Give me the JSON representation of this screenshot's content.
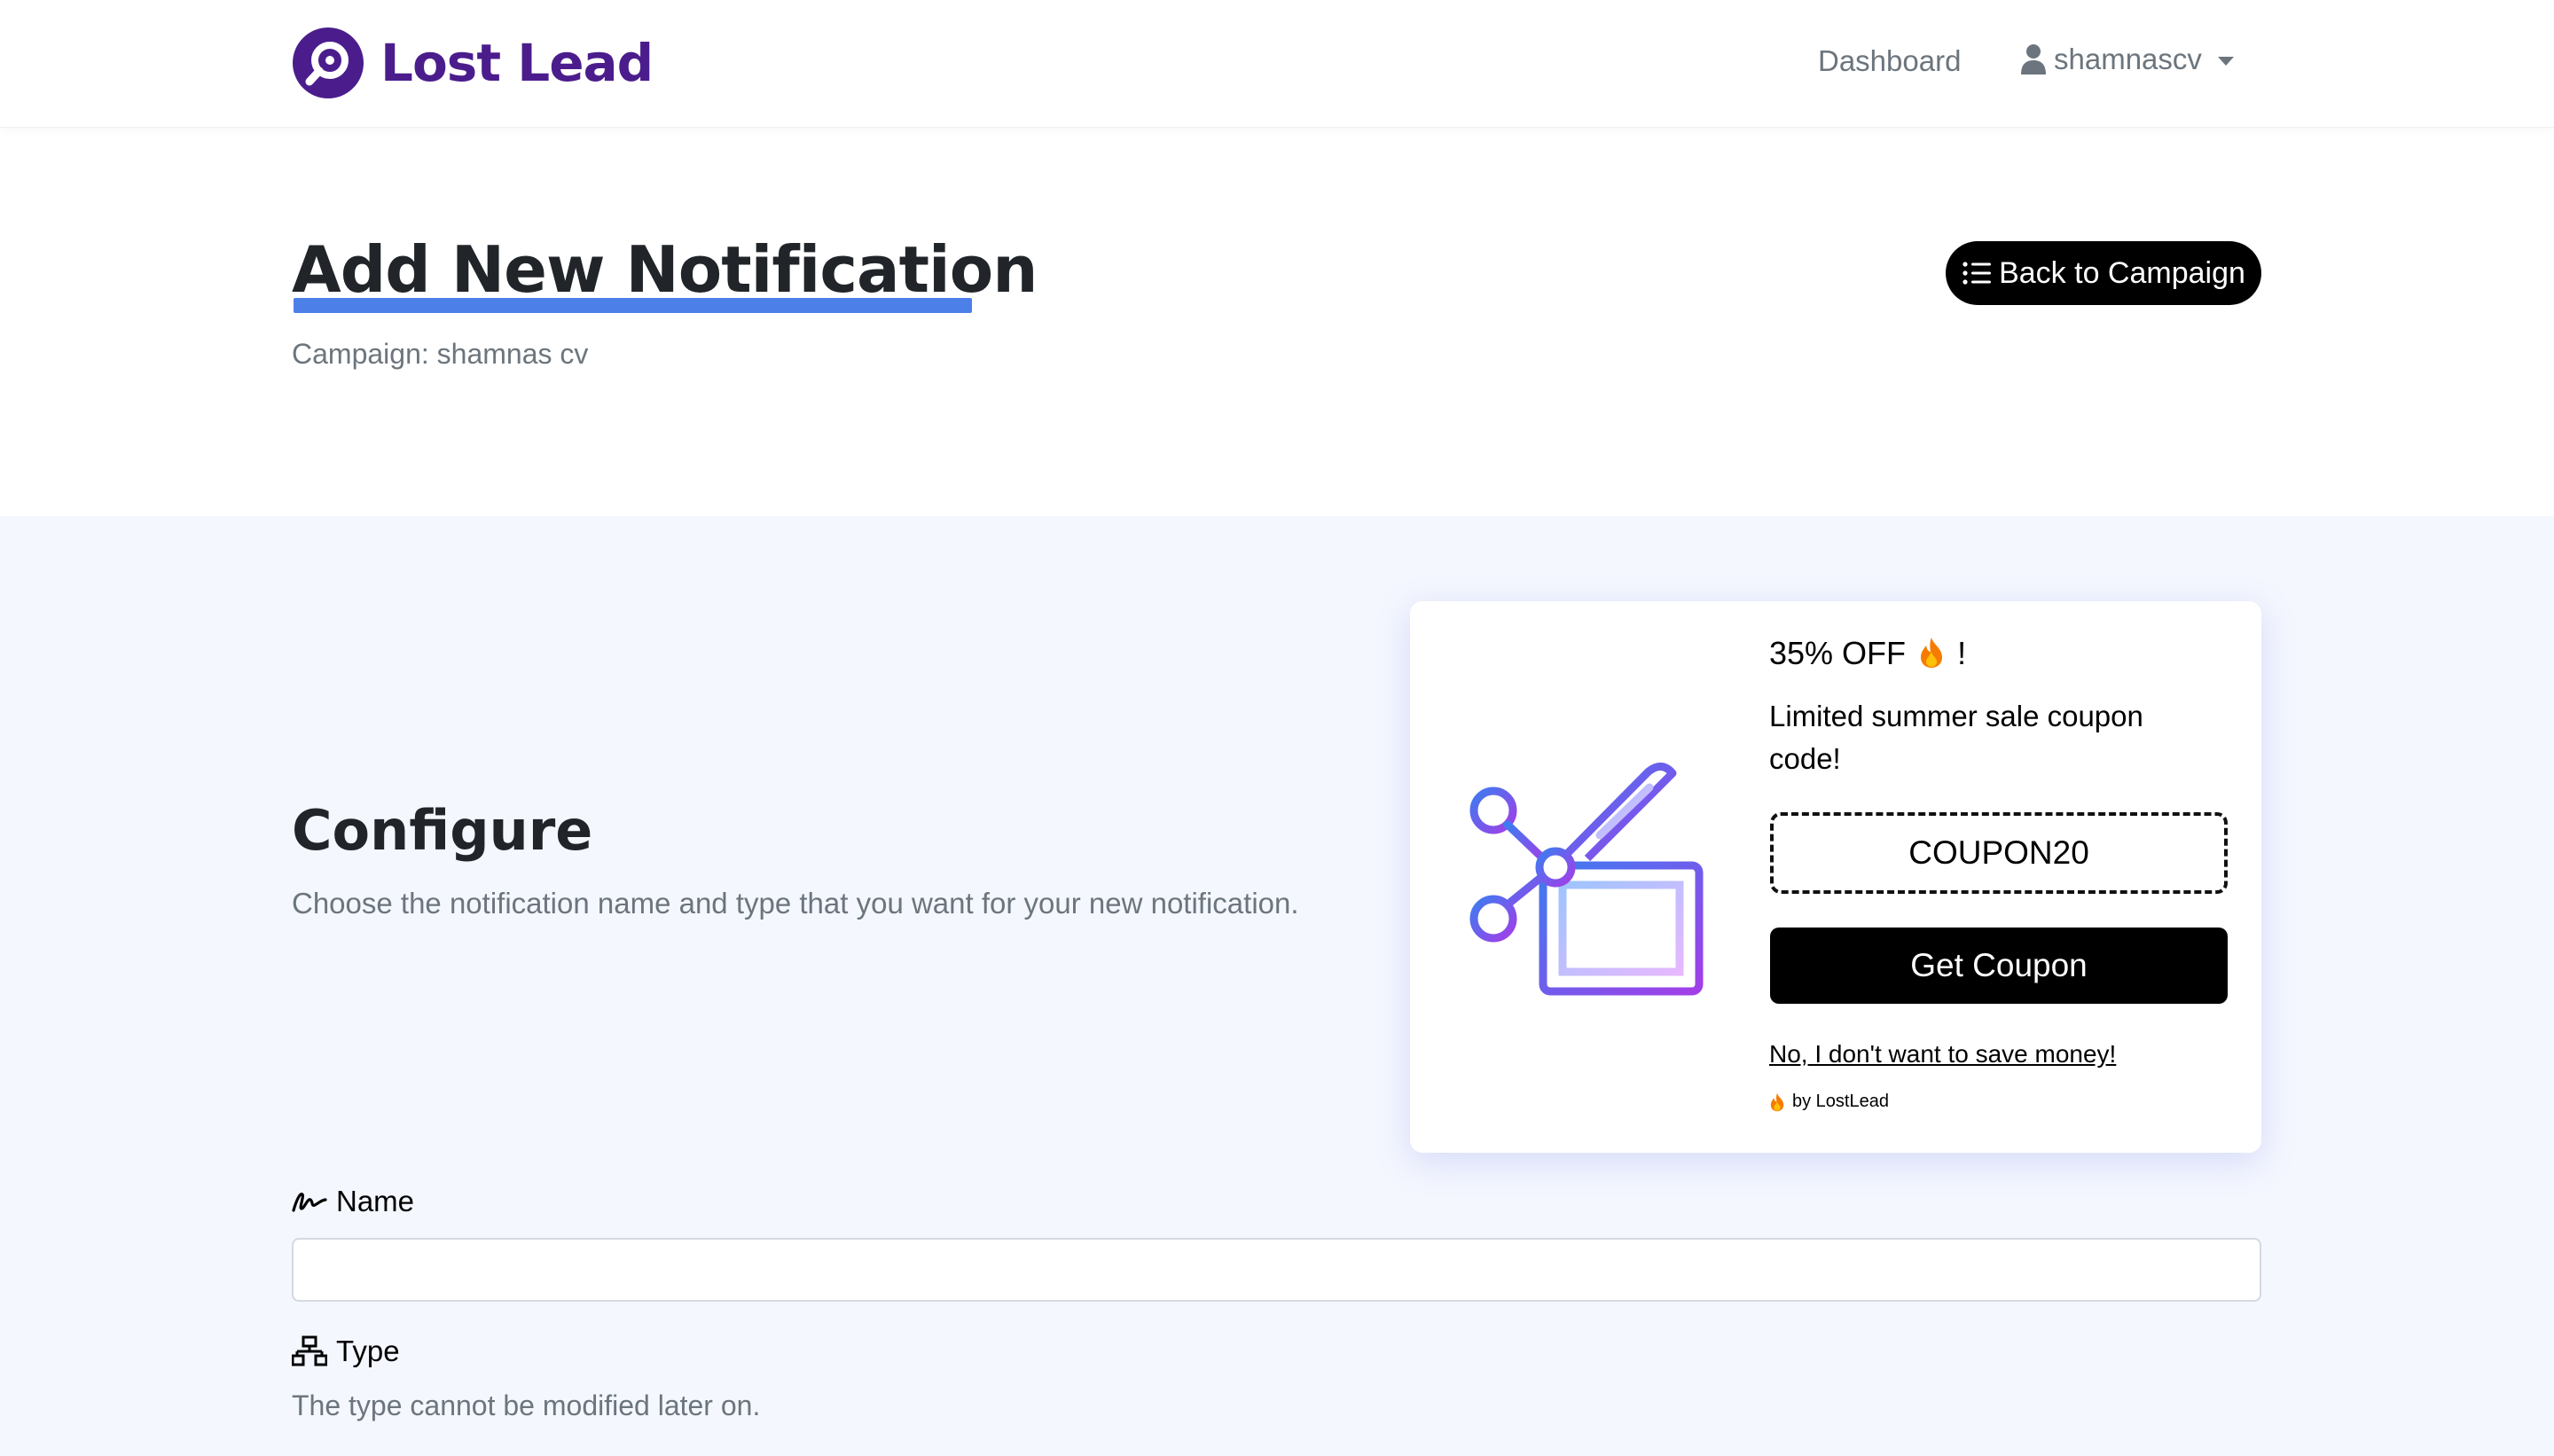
{
  "navbar": {
    "brand_name": "Lost Lead",
    "dashboard_label": "Dashboard",
    "user_name": "shamnascv"
  },
  "header": {
    "title": "Add New Notification",
    "campaign_line": "Campaign: shamnas cv",
    "back_button_label": "Back to Campaign"
  },
  "configure": {
    "title": "Configure",
    "description": "Choose the notification name and type that you want for your new notification."
  },
  "coupon_preview": {
    "heading_text": "35% OFF",
    "heading_suffix": "!",
    "description": "Limited summer sale coupon code!",
    "code": "COUPON20",
    "button_label": "Get Coupon",
    "dismiss_label": "No, I don't want to save money!",
    "branding": "by LostLead"
  },
  "form": {
    "name_label": "Name",
    "name_value": "",
    "type_label": "Type",
    "type_help": "The type cannot be modified later on."
  },
  "colors": {
    "brand_purple": "#4b1d8c",
    "title_underline": "#4d7fe8",
    "section_background": "#f4f7fe",
    "button_black": "#000000"
  },
  "icons": {
    "brand": "magnifier-logo-icon",
    "user": "user-icon",
    "back_button": "list-icon",
    "coupon_heading": "fire-icon",
    "name_label": "signature-icon",
    "type_label": "network-icon"
  }
}
